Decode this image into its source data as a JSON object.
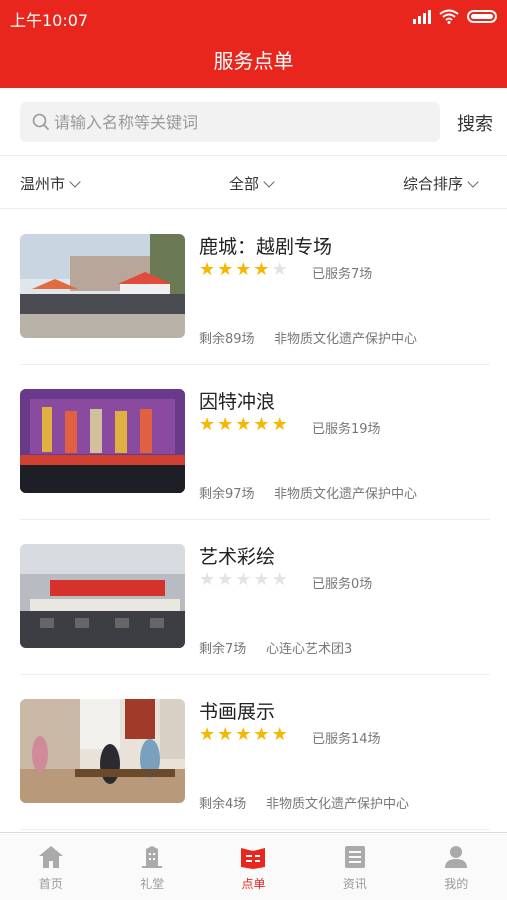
{
  "status": {
    "time": "上午10:07"
  },
  "header": {
    "title": "服务点单"
  },
  "search": {
    "placeholder": "请输入名称等关键词",
    "button": "搜索"
  },
  "filters": {
    "city": "温州市",
    "category": "全部",
    "sort": "综合排序"
  },
  "items": [
    {
      "title": "鹿城：越剧专场",
      "rating": 4,
      "served": "已服务7场",
      "remain": "剩余89场",
      "org": "非物质文化遗产保护中心"
    },
    {
      "title": "因特冲浪",
      "rating": 5,
      "served": "已服务19场",
      "remain": "剩余97场",
      "org": "非物质文化遗产保护中心"
    },
    {
      "title": "艺术彩绘",
      "rating": 0,
      "served": "已服务0场",
      "remain": "剩余7场",
      "org": "心连心艺术团3"
    },
    {
      "title": "书画展示",
      "rating": 5,
      "served": "已服务14场",
      "remain": "剩余4场",
      "org": "非物质文化遗产保护中心"
    }
  ],
  "tabs": [
    {
      "label": "首页",
      "icon": "home-icon"
    },
    {
      "label": "礼堂",
      "icon": "hall-icon"
    },
    {
      "label": "点单",
      "icon": "order-icon",
      "active": true
    },
    {
      "label": "资讯",
      "icon": "news-icon"
    },
    {
      "label": "我的",
      "icon": "user-icon"
    }
  ],
  "colors": {
    "brand": "#e8261d",
    "star": "#f5b800",
    "star_off": "#e3e3e3"
  }
}
